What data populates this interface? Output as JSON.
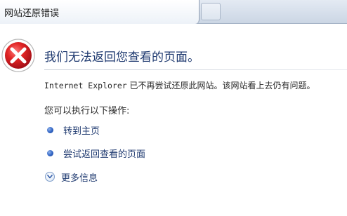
{
  "tab": {
    "title": "网站还原错误"
  },
  "error": {
    "heading": "我们无法返回您查看的页面。",
    "message_mono": "Internet Explorer",
    "message_rest": " 已不再尝试还原此网站。该网站看上去仍有问题。",
    "prompt": "您可以执行以下操作:"
  },
  "options": [
    {
      "label": "转到主页",
      "icon": "bullet-icon"
    },
    {
      "label": "尝试返回查看的页面",
      "icon": "bullet-icon"
    },
    {
      "label": "更多信息",
      "icon": "chevron-down-icon"
    }
  ],
  "colors": {
    "heading": "#1f3a70",
    "error_red": "#c8102e",
    "link": "#1f3a70"
  }
}
